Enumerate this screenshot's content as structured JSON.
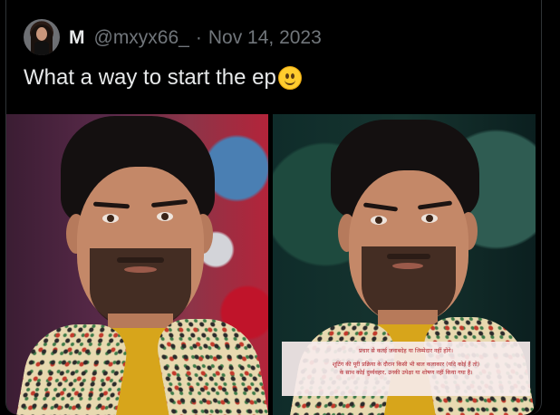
{
  "tweet": {
    "author_name": "M",
    "author_handle": "@mxyx66_",
    "separator": "·",
    "date": "Nov 14, 2023",
    "text": "What a way to start the ep",
    "emoji": "slightly-smiling-face-emoji"
  },
  "media": {
    "subtitle_line1": "प्रचार से कतई जवाबदेह या जिम्मेदार नहीं होंगे।",
    "subtitle_line2": "शूटिंग की पूरी प्रक्रिया के दौरान किसी भी बाल कलाकार (यदि कोई हैं तो)",
    "subtitle_line3": "के साथ कोई दुर्व्यवहार, उनकी उपेक्षा या शोषण नहीं किया गया है।"
  },
  "colors": {
    "background": "#000000",
    "primary_text": "#e7e9ea",
    "secondary_text": "#71767b",
    "subtitle_text": "#b3262e"
  }
}
